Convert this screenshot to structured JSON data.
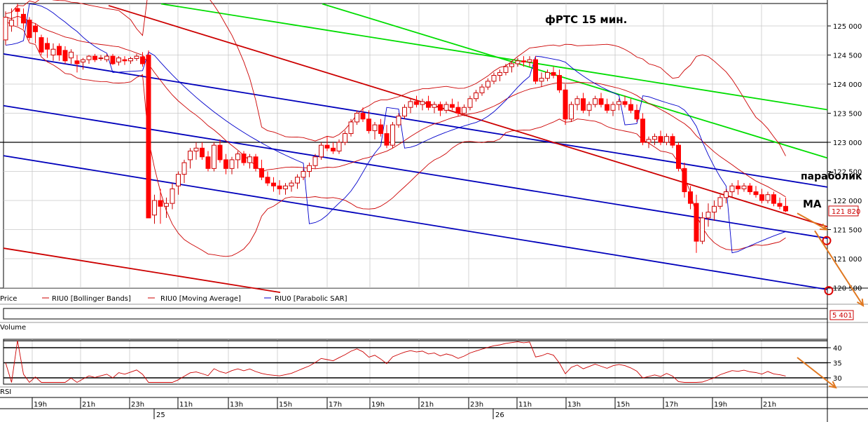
{
  "chart_data": {
    "type": "candlestick",
    "title": "фРТС   15 мин.",
    "price_axis": {
      "ticks": [
        125000,
        124500,
        124000,
        123500,
        123000,
        122500,
        122000,
        121500,
        121000,
        120500
      ],
      "tick_labels": [
        "125 000",
        "124 500",
        "124 000",
        "123 500",
        "123 000",
        "122 500",
        "122 000",
        "121 500",
        "121 000",
        "120 500"
      ],
      "range": [
        120420,
        125400
      ],
      "last_price_label": "121 820"
    },
    "time_axis": {
      "labels": [
        "19h",
        "21h",
        "23h",
        "11h",
        "13h",
        "15h",
        "17h",
        "19h",
        "21h",
        "23h",
        "11h",
        "13h",
        "15h",
        "17h",
        "19h",
        "21h"
      ],
      "day_labels": [
        "25",
        "26"
      ]
    },
    "candles": [
      [
        124760,
        125250,
        124670,
        125150
      ],
      [
        125000,
        125300,
        124900,
        125100
      ],
      [
        125300,
        125380,
        125000,
        125250
      ],
      [
        125200,
        125300,
        124950,
        125050
      ],
      [
        125100,
        125150,
        124750,
        124800
      ],
      [
        125000,
        125050,
        124700,
        124900
      ],
      [
        124800,
        124850,
        124500,
        124550
      ],
      [
        124700,
        124800,
        124450,
        124600
      ],
      [
        124500,
        124700,
        124400,
        124600
      ],
      [
        124650,
        124700,
        124400,
        124500
      ],
      [
        124580,
        124650,
        124350,
        124400
      ],
      [
        124450,
        124600,
        124350,
        124550
      ],
      [
        124400,
        124500,
        124200,
        124350
      ],
      [
        124380,
        124450,
        124250,
        124420
      ],
      [
        124420,
        124500,
        124350,
        124480
      ],
      [
        124480,
        124520,
        124380,
        124420
      ],
      [
        124450,
        124500,
        124400,
        124450
      ],
      [
        124420,
        124520,
        124380,
        124480
      ],
      [
        124480,
        124520,
        124330,
        124350
      ],
      [
        124380,
        124480,
        124320,
        124450
      ],
      [
        124420,
        124480,
        124330,
        124400
      ],
      [
        124400,
        124470,
        124350,
        124440
      ],
      [
        124440,
        124520,
        124400,
        124480
      ],
      [
        124470,
        124550,
        124300,
        124350
      ],
      [
        124500,
        124580,
        121700,
        121700
      ],
      [
        121750,
        122100,
        121600,
        122000
      ],
      [
        122000,
        122200,
        121600,
        121900
      ],
      [
        121900,
        122050,
        121700,
        121950
      ],
      [
        121950,
        122300,
        121850,
        122200
      ],
      [
        122250,
        122500,
        122100,
        122450
      ],
      [
        122450,
        122700,
        122300,
        122650
      ],
      [
        122700,
        122900,
        122550,
        122850
      ],
      [
        122850,
        123000,
        122700,
        122900
      ],
      [
        122900,
        123000,
        122700,
        122750
      ],
      [
        122750,
        122850,
        122500,
        122550
      ],
      [
        122550,
        123000,
        122500,
        122950
      ],
      [
        122950,
        123050,
        122650,
        122700
      ],
      [
        122700,
        122800,
        122450,
        122550
      ],
      [
        122550,
        122750,
        122450,
        122700
      ],
      [
        122700,
        122850,
        122550,
        122800
      ],
      [
        122800,
        122850,
        122600,
        122650
      ],
      [
        122650,
        122800,
        122550,
        122750
      ],
      [
        122750,
        122800,
        122500,
        122550
      ],
      [
        122550,
        122700,
        122350,
        122400
      ],
      [
        122400,
        122500,
        122250,
        122300
      ],
      [
        122300,
        122400,
        122150,
        122250
      ],
      [
        122250,
        122350,
        122100,
        122200
      ],
      [
        122200,
        122300,
        122100,
        122250
      ],
      [
        122250,
        122350,
        122150,
        122300
      ],
      [
        122300,
        122450,
        122200,
        122400
      ],
      [
        122400,
        122550,
        122350,
        122500
      ],
      [
        122500,
        122650,
        122400,
        122600
      ],
      [
        122600,
        122800,
        122550,
        122750
      ],
      [
        122750,
        123000,
        122700,
        122950
      ],
      [
        122950,
        123100,
        122850,
        122900
      ],
      [
        122900,
        123000,
        122800,
        122850
      ],
      [
        122850,
        123050,
        122800,
        123000
      ],
      [
        123000,
        123200,
        122950,
        123150
      ],
      [
        123150,
        123400,
        123100,
        123350
      ],
      [
        123350,
        123550,
        123300,
        123500
      ],
      [
        123500,
        123600,
        123350,
        123400
      ],
      [
        123400,
        123550,
        123150,
        123200
      ],
      [
        123200,
        123350,
        123050,
        123300
      ],
      [
        123300,
        123400,
        123100,
        123150
      ],
      [
        123150,
        123300,
        122900,
        122950
      ],
      [
        122950,
        123350,
        122900,
        123300
      ],
      [
        123300,
        123500,
        123250,
        123450
      ],
      [
        123450,
        123650,
        123400,
        123600
      ],
      [
        123600,
        123750,
        123500,
        123700
      ],
      [
        123700,
        123800,
        123600,
        123650
      ],
      [
        123650,
        123750,
        123550,
        123700
      ],
      [
        123700,
        123800,
        123550,
        123600
      ],
      [
        123600,
        123700,
        123500,
        123650
      ],
      [
        123650,
        123700,
        123450,
        123550
      ],
      [
        123550,
        123700,
        123500,
        123650
      ],
      [
        123650,
        123750,
        123550,
        123600
      ],
      [
        123600,
        123700,
        123450,
        123500
      ],
      [
        123500,
        123650,
        123450,
        123600
      ],
      [
        123600,
        123800,
        123550,
        123750
      ],
      [
        123750,
        123900,
        123700,
        123850
      ],
      [
        123850,
        124000,
        123800,
        123950
      ],
      [
        123950,
        124100,
        123900,
        124050
      ],
      [
        124050,
        124200,
        124000,
        124150
      ],
      [
        124150,
        124250,
        124050,
        124200
      ],
      [
        124200,
        124350,
        124150,
        124300
      ],
      [
        124300,
        124400,
        124200,
        124350
      ],
      [
        124350,
        124450,
        124300,
        124400
      ],
      [
        124400,
        124480,
        124300,
        124380
      ],
      [
        124380,
        124480,
        124300,
        124420
      ],
      [
        124420,
        124480,
        124000,
        124050
      ],
      [
        124050,
        124200,
        123950,
        124100
      ],
      [
        124100,
        124250,
        124050,
        124200
      ],
      [
        124200,
        124300,
        124100,
        124150
      ],
      [
        124150,
        124250,
        123850,
        123900
      ],
      [
        123900,
        124000,
        123300,
        123400
      ],
      [
        123400,
        123700,
        123350,
        123650
      ],
      [
        123650,
        123800,
        123550,
        123750
      ],
      [
        123750,
        123850,
        123500,
        123550
      ],
      [
        123550,
        123700,
        123450,
        123650
      ],
      [
        123650,
        123800,
        123600,
        123750
      ],
      [
        123750,
        123850,
        123600,
        123650
      ],
      [
        123650,
        123750,
        123500,
        123550
      ],
      [
        123550,
        123700,
        123450,
        123650
      ],
      [
        123650,
        123750,
        123550,
        123700
      ],
      [
        123700,
        123800,
        123600,
        123650
      ],
      [
        123650,
        123750,
        123500,
        123550
      ],
      [
        123550,
        123650,
        123350,
        123400
      ],
      [
        123400,
        123500,
        122950,
        123000
      ],
      [
        123000,
        123100,
        122900,
        123050
      ],
      [
        123050,
        123150,
        122950,
        123100
      ],
      [
        123100,
        123200,
        122950,
        123000
      ],
      [
        123000,
        123150,
        122950,
        123100
      ],
      [
        123100,
        123150,
        122900,
        122950
      ],
      [
        122950,
        123000,
        122500,
        122550
      ],
      [
        122550,
        122650,
        122050,
        122150
      ],
      [
        122150,
        122250,
        121850,
        121950
      ],
      [
        121950,
        122100,
        121100,
        121300
      ],
      [
        121300,
        121800,
        121250,
        121700
      ],
      [
        121700,
        121950,
        121550,
        121800
      ],
      [
        121800,
        122000,
        121650,
        121900
      ],
      [
        121900,
        122100,
        121850,
        122050
      ],
      [
        122050,
        122200,
        121950,
        122150
      ],
      [
        122150,
        122300,
        122050,
        122250
      ],
      [
        122250,
        122350,
        122100,
        122200
      ],
      [
        122200,
        122300,
        122150,
        122250
      ],
      [
        122250,
        122300,
        122100,
        122150
      ],
      [
        122150,
        122250,
        122050,
        122100
      ],
      [
        122100,
        122200,
        121950,
        122000
      ],
      [
        122000,
        122150,
        121950,
        122100
      ],
      [
        122100,
        122150,
        121900,
        121950
      ],
      [
        121950,
        122050,
        121850,
        121900
      ],
      [
        121900,
        122050,
        121800,
        121820
      ]
    ],
    "overlays": [
      {
        "name": "RIU0 [Bollinger Bands]",
        "color": "#cc0000"
      },
      {
        "name": "RIU0 [Moving Average]",
        "color": "#cc0000"
      },
      {
        "name": "RIU0 [Parabolic SAR]",
        "color": "#0000cc"
      }
    ],
    "legend_left_label": "Price",
    "colors": {
      "bull": "#cc0000",
      "bear": "#ff0000",
      "regression_channel": "#0000bb",
      "downtrend_line": "#cc0000",
      "resistance_line": "#00dd00",
      "projection_arrow": "#e07820"
    },
    "annotations": [
      "фРТС   15 мин.",
      "параболик",
      "МА"
    ],
    "volume_panel": {
      "label": "Volume",
      "value_label": "5 401"
    },
    "rsi_panel": {
      "label": "RSI",
      "levels": [
        40,
        35,
        30
      ],
      "level_labels": [
        "40",
        "35",
        "30"
      ],
      "range": [
        28,
        43
      ]
    }
  }
}
